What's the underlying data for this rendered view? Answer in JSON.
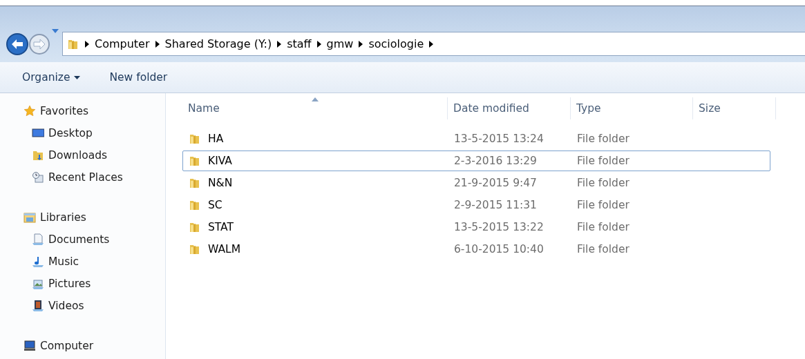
{
  "navigation": {
    "back_enabled": true,
    "forward_enabled": false,
    "breadcrumbs": [
      "Computer",
      "Shared Storage (Y:)",
      "staff",
      "gmw",
      "sociologie"
    ]
  },
  "toolbar": {
    "buttons": [
      {
        "label": "Organize",
        "has_menu": true
      },
      {
        "label": "New folder",
        "has_menu": false
      }
    ]
  },
  "sidebar": {
    "groups": [
      {
        "label": "Favorites",
        "children": [
          {
            "label": "Desktop"
          },
          {
            "label": "Downloads"
          },
          {
            "label": "Recent Places"
          }
        ]
      },
      {
        "label": "Libraries",
        "children": [
          {
            "label": "Documents"
          },
          {
            "label": "Music"
          },
          {
            "label": "Pictures"
          },
          {
            "label": "Videos"
          }
        ]
      },
      {
        "label": "Computer"
      }
    ]
  },
  "file_list": {
    "columns": [
      {
        "label": "Name",
        "sorted": true
      },
      {
        "label": "Date modified",
        "sorted": false
      },
      {
        "label": "Type",
        "sorted": false
      },
      {
        "label": "Size",
        "sorted": false
      }
    ],
    "rows": [
      {
        "name": "HA",
        "date_modified": "13-5-2015 13:24",
        "type": "File folder",
        "focused": false
      },
      {
        "name": "KIVA",
        "date_modified": "2-3-2016 13:29",
        "type": "File folder",
        "focused": true
      },
      {
        "name": "N&N",
        "date_modified": "21-9-2015 9:47",
        "type": "File folder",
        "focused": false
      },
      {
        "name": "SC",
        "date_modified": "2-9-2015 11:31",
        "type": "File folder",
        "focused": false
      },
      {
        "name": "STAT",
        "date_modified": "13-5-2015 13:22",
        "type": "File folder",
        "focused": false
      },
      {
        "name": "WALM",
        "date_modified": "6-10-2015 10:40",
        "type": "File folder",
        "focused": false
      }
    ]
  }
}
